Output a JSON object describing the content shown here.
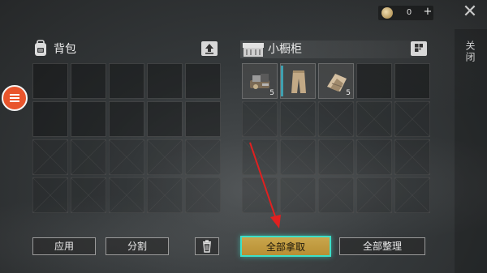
{
  "currency": {
    "amount": "0",
    "plus_label": "+"
  },
  "close": {
    "label": "关闭",
    "icon": "close-x-icon"
  },
  "backpack": {
    "title": "背包",
    "slots_unlocked": 10,
    "slots_locked": 10
  },
  "cabinet": {
    "title": "小橱柜",
    "items": [
      {
        "name": "crafting-parts",
        "qty": "5"
      },
      {
        "name": "pants",
        "qty": ""
      },
      {
        "name": "cloth-scraps",
        "qty": "5"
      }
    ],
    "slots_unlocked": 5,
    "slots_locked": 15
  },
  "buttons": {
    "apply": "应用",
    "split": "分割",
    "take_all": "全部拿取",
    "sort_all": "全部整理"
  },
  "colors": {
    "menu_orange": "#e9552c",
    "take_all_gold": "#c9a64c",
    "highlight_teal": "#3de0c8",
    "arrow_red": "#e02020"
  }
}
